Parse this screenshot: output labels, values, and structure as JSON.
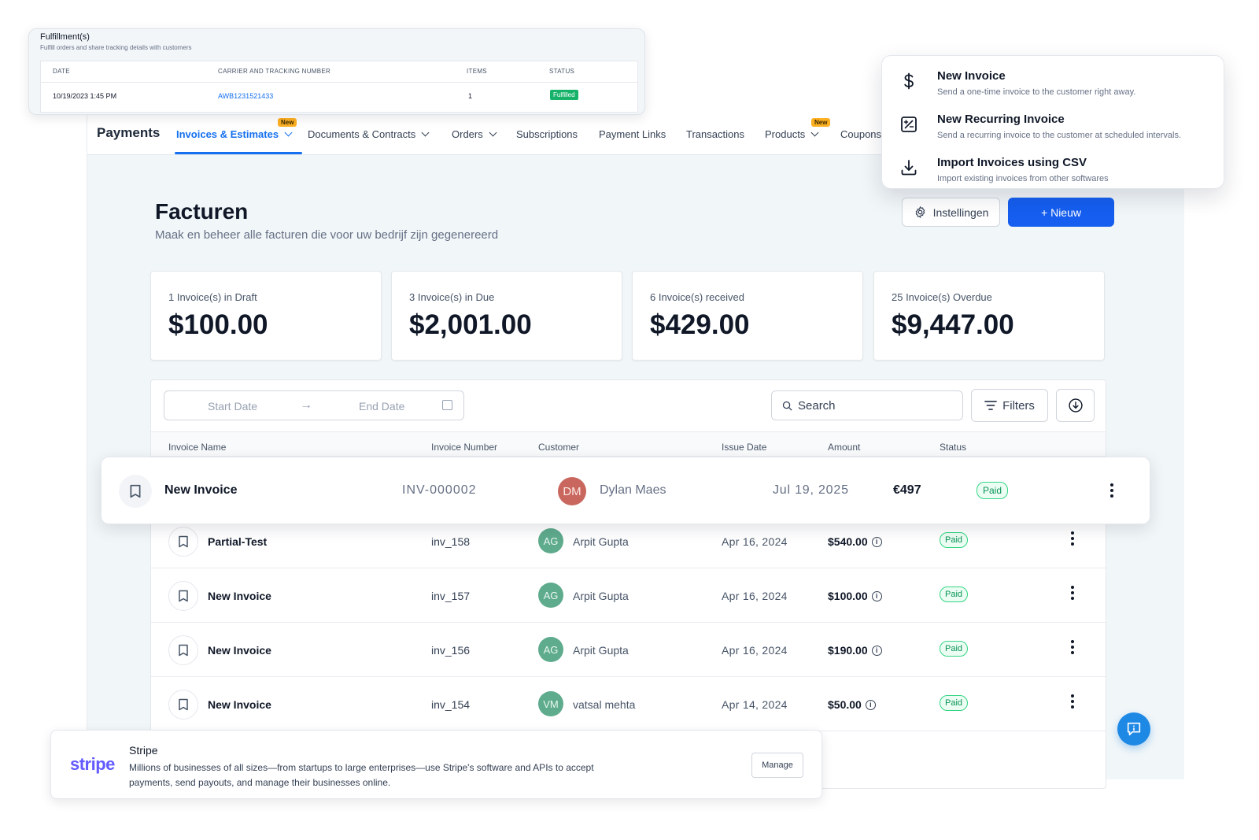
{
  "fulfillment": {
    "title": "Fulfillment(s)",
    "subtitle": "Fulfill orders and share tracking details with customers",
    "columns": [
      "DATE",
      "CARRIER AND TRACKING NUMBER",
      "ITEMS",
      "STATUS"
    ],
    "row": {
      "date": "10/19/2023 1:45 PM",
      "tracking": "AWB1231521433",
      "items": "1",
      "status": "Fulfilled"
    }
  },
  "nav": {
    "brand": "Payments",
    "items": [
      {
        "label": "Invoices & Estimates",
        "badge": "New",
        "active": true
      },
      {
        "label": "Documents & Contracts"
      },
      {
        "label": "Orders"
      },
      {
        "label": "Subscriptions"
      },
      {
        "label": "Payment Links"
      },
      {
        "label": "Transactions"
      },
      {
        "label": "Products",
        "badge": "New"
      },
      {
        "label": "Coupons"
      }
    ]
  },
  "menu": {
    "items": [
      {
        "title": "New Invoice",
        "desc": "Send a one-time invoice to the customer right away.",
        "icon": "dollar-icon"
      },
      {
        "title": "New Recurring Invoice",
        "desc": "Send a recurring invoice to the customer at scheduled intervals.",
        "icon": "recurring-invoice-icon"
      },
      {
        "title": "Import Invoices using CSV",
        "desc": "Import existing invoices from other softwares",
        "icon": "download-icon"
      }
    ]
  },
  "header": {
    "title": "Facturen",
    "subtitle": "Maak en beheer alle facturen die voor uw bedrijf zijn gegenereerd",
    "settings_label": "Instellingen",
    "new_label": "+ Nieuw"
  },
  "stats": [
    {
      "label": "1 Invoice(s) in Draft",
      "value": "$100.00"
    },
    {
      "label": "3 Invoice(s) in Due",
      "value": "$2,001.00"
    },
    {
      "label": "6 Invoice(s) received",
      "value": "$429.00"
    },
    {
      "label": "25 Invoice(s) Overdue",
      "value": "$9,447.00"
    }
  ],
  "toolbar": {
    "start_placeholder": "Start Date",
    "end_placeholder": "End Date",
    "search_placeholder": "Search",
    "filters_label": "Filters"
  },
  "table": {
    "columns": [
      "Invoice Name",
      "Invoice Number",
      "Customer",
      "Issue Date",
      "Amount",
      "Status"
    ],
    "highlight": {
      "name": "New Invoice",
      "number": "INV-000002",
      "initials": "DM",
      "customer": "Dylan Maes",
      "date": "Jul 19, 2025",
      "amount": "€497",
      "status": "Paid"
    },
    "rows": [
      {
        "name": "Partial-Test",
        "number": "inv_158",
        "initials": "AG",
        "customer": "Arpit Gupta",
        "date": "Apr 16, 2024",
        "amount": "$540.00",
        "status": "Paid"
      },
      {
        "name": "New Invoice",
        "number": "inv_157",
        "initials": "AG",
        "customer": "Arpit Gupta",
        "date": "Apr 16, 2024",
        "amount": "$100.00",
        "status": "Paid"
      },
      {
        "name": "New Invoice",
        "number": "inv_156",
        "initials": "AG",
        "customer": "Arpit Gupta",
        "date": "Apr 16, 2024",
        "amount": "$190.00",
        "status": "Paid"
      },
      {
        "name": "New Invoice",
        "number": "inv_154",
        "initials": "VM",
        "customer": "vatsal mehta",
        "date": "Apr 14, 2024",
        "amount": "$50.00",
        "status": "Paid"
      }
    ]
  },
  "stripe": {
    "logo": "stripe",
    "title": "Stripe",
    "desc": "Millions of businesses of all sizes—from startups to large enterprises—use Stripe's software and APIs to accept payments, send payouts, and manage their businesses online.",
    "manage_label": "Manage"
  },
  "colors": {
    "accent": "#155eef",
    "active_tab": "#1570ef",
    "paid": "#079455",
    "stripe": "#635bff"
  }
}
